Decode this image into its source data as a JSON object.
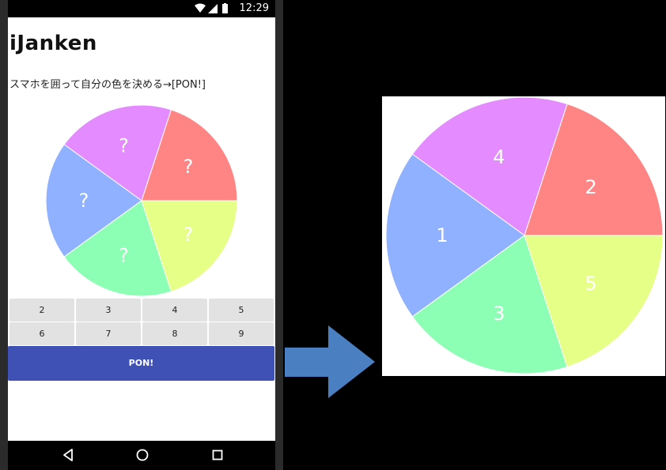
{
  "status_bar": {
    "time": "12:29",
    "icons": [
      "wifi-icon",
      "signal-icon",
      "battery-icon"
    ]
  },
  "app": {
    "title": "iJanken",
    "instruction": "スマホを囲って自分の色を決める→[PON!]",
    "wheel": {
      "segments": [
        {
          "color": "#ff8585",
          "label": "?"
        },
        {
          "color": "#e38bff",
          "label": "?"
        },
        {
          "color": "#8fb1ff",
          "label": "?"
        },
        {
          "color": "#8dffb4",
          "label": "?"
        },
        {
          "color": "#e6ff86",
          "label": "?"
        }
      ]
    },
    "number_buttons": [
      "2",
      "3",
      "4",
      "5",
      "6",
      "7",
      "8",
      "9"
    ],
    "pon_label": "PON!",
    "pon_color": "#3f51b5"
  },
  "nav": {
    "icons": [
      "back-icon",
      "home-icon",
      "recents-icon"
    ]
  },
  "arrow": {
    "icon": "right-arrow-icon",
    "color": "#4a7fc1"
  },
  "result": {
    "wheel": {
      "segments": [
        {
          "color": "#ff8585",
          "label": "2"
        },
        {
          "color": "#e38bff",
          "label": "4"
        },
        {
          "color": "#8fb1ff",
          "label": "1"
        },
        {
          "color": "#8dffb4",
          "label": "3"
        },
        {
          "color": "#e6ff86",
          "label": "5"
        }
      ]
    }
  }
}
